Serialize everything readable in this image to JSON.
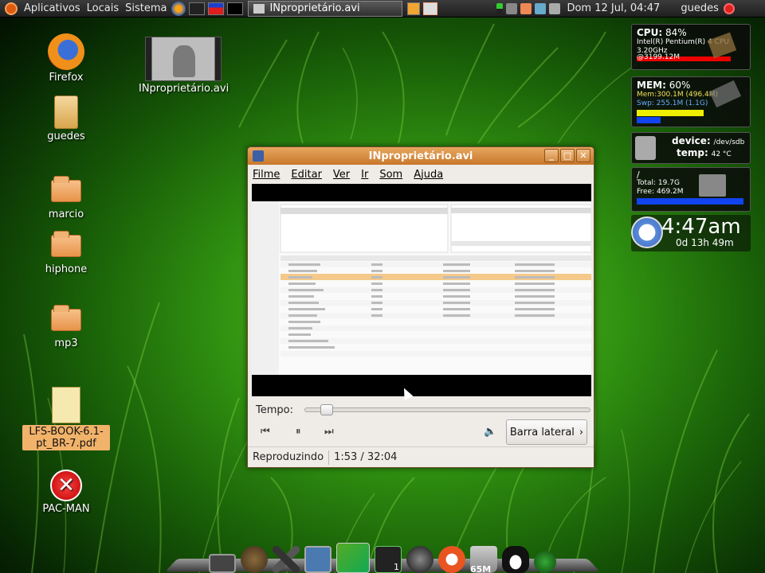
{
  "top_panel": {
    "menu": [
      "Aplicativos",
      "Locais",
      "Sistema"
    ],
    "task": "INproprietário.avi",
    "clock": "Dom 12 Jul, 04:47",
    "user": "guedes"
  },
  "desktop_icons": [
    {
      "label": "Firefox"
    },
    {
      "label": "INproprietário.avi"
    },
    {
      "label": "guedes"
    },
    {
      "label": "marcio"
    },
    {
      "label": "hiphone"
    },
    {
      "label": "mp3"
    },
    {
      "label": "LFS-BOOK-6.1-pt_BR-7.pdf"
    },
    {
      "label": "PAC-MAN"
    }
  ],
  "conky": {
    "cpu": {
      "label": "CPU:",
      "value": "84%",
      "line1": "Intel(R) Pentium(R) 4 CPU",
      "line2": "3.20GHz",
      "line3": "@3199.12M",
      "percent": 84
    },
    "mem": {
      "label": "MEM:",
      "value": "60%",
      "line1": "Mem:300.1M (496.4M)",
      "line2": "Swp: 255.1M (1.1G)",
      "mem_fill": 0.6,
      "swap_fill": 0.23
    },
    "device": {
      "label1": "device:",
      "value1": "/dev/sdb",
      "label2": "temp:",
      "value2": "42 °C"
    },
    "disk": {
      "mount": "/",
      "total": "Total: 19.7G",
      "free": "Free: 469.2M",
      "fill": 0.97
    },
    "clock": {
      "time": "4:47am",
      "uptime": "0d 13h 49m"
    }
  },
  "player": {
    "title": "INproprietário.avi",
    "menu": [
      "Filme",
      "Editar",
      "Ver",
      "Ir",
      "Som",
      "Ajuda"
    ],
    "seek_label": "Tempo:",
    "seek_position": 0.056,
    "sidebar_button": "Barra lateral",
    "status": "Reproduzindo",
    "time": "1:53 / 32:04"
  },
  "dock": {
    "badge_1": "1",
    "badge_65m": "65M"
  }
}
